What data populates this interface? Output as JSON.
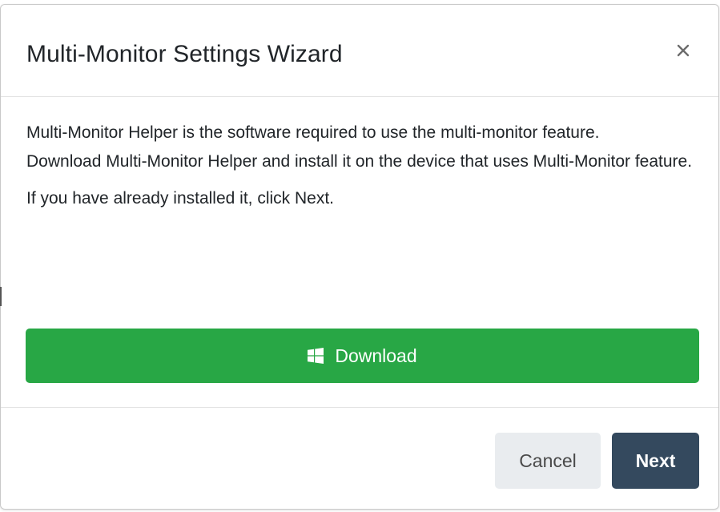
{
  "dialog": {
    "title": "Multi-Monitor Settings Wizard",
    "close_symbol": "×",
    "body": {
      "paragraph1": "Multi-Monitor Helper is the software required to use the multi-monitor feature.",
      "paragraph2": "Download Multi-Monitor Helper and install it on the device that uses Multi-Monitor feature.",
      "paragraph3": "If you have already installed it, click Next."
    },
    "download_button": {
      "label": "Download",
      "icon": "windows-logo-icon",
      "color": "#28a745"
    },
    "footer": {
      "cancel_label": "Cancel",
      "next_label": "Next",
      "next_color": "#34495e"
    }
  }
}
